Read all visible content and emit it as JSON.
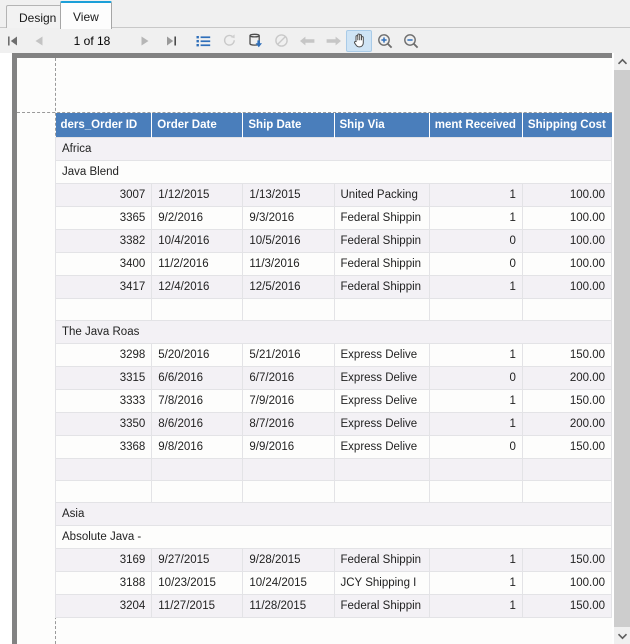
{
  "tabs": [
    {
      "label": "Design",
      "active": false
    },
    {
      "label": "View",
      "active": true
    }
  ],
  "toolbar": {
    "first_page_label": "first-page",
    "prev_page_label": "previous-page",
    "page_indicator": "1 of 18",
    "next_page_label": "next-page",
    "last_page_label": "last-page",
    "toc_label": "table-of-contents",
    "refresh_label": "refresh",
    "export_label": "export",
    "stop_label": "stop",
    "back_label": "back",
    "forward_label": "forward",
    "pan_label": "pan-tool",
    "zoom_in_label": "zoom-in",
    "zoom_out_label": "zoom-out",
    "active_tool": "pan-tool"
  },
  "colors": {
    "header_fill": "#4a7ebb",
    "tab_accent": "#1b9fd8",
    "alt_row": "#f3f1f5",
    "page_bg": "#fdfdfc",
    "frame_gray": "#828282"
  },
  "report": {
    "columns": [
      "ders_Order ID",
      "Order Date",
      "Ship Date",
      "Ship Via",
      "ment Received",
      "Shipping Cost"
    ],
    "rows": [
      {
        "kind": "group",
        "level": 1,
        "label": "Africa",
        "shade": "alt"
      },
      {
        "kind": "group",
        "level": 2,
        "label": "Java Blend",
        "shade": "plain"
      },
      {
        "kind": "data",
        "shade": "alt",
        "cells": [
          "3007",
          "1/12/2015",
          "1/13/2015",
          "United Packing",
          "1",
          "100.00"
        ]
      },
      {
        "kind": "data",
        "shade": "plain",
        "cells": [
          "3365",
          "9/2/2016",
          "9/3/2016",
          "Federal Shippin",
          "1",
          "100.00"
        ]
      },
      {
        "kind": "data",
        "shade": "alt",
        "cells": [
          "3382",
          "10/4/2016",
          "10/5/2016",
          "Federal Shippin",
          "0",
          "100.00"
        ]
      },
      {
        "kind": "data",
        "shade": "plain",
        "cells": [
          "3400",
          "11/2/2016",
          "11/3/2016",
          "Federal Shippin",
          "0",
          "100.00"
        ]
      },
      {
        "kind": "data",
        "shade": "alt",
        "cells": [
          "3417",
          "12/4/2016",
          "12/5/2016",
          "Federal Shippin",
          "1",
          "100.00"
        ]
      },
      {
        "kind": "spacer",
        "shade": "plain"
      },
      {
        "kind": "group",
        "level": 2,
        "label": "The Java Roas",
        "shade": "alt"
      },
      {
        "kind": "data",
        "shade": "plain",
        "cells": [
          "3298",
          "5/20/2016",
          "5/21/2016",
          "Express Delive",
          "1",
          "150.00"
        ]
      },
      {
        "kind": "data",
        "shade": "alt",
        "cells": [
          "3315",
          "6/6/2016",
          "6/7/2016",
          "Express Delive",
          "0",
          "200.00"
        ]
      },
      {
        "kind": "data",
        "shade": "plain",
        "cells": [
          "3333",
          "7/8/2016",
          "7/9/2016",
          "Express Delive",
          "1",
          "150.00"
        ]
      },
      {
        "kind": "data",
        "shade": "alt",
        "cells": [
          "3350",
          "8/6/2016",
          "8/7/2016",
          "Express Delive",
          "1",
          "200.00"
        ]
      },
      {
        "kind": "data",
        "shade": "plain",
        "cells": [
          "3368",
          "9/8/2016",
          "9/9/2016",
          "Express Delive",
          "0",
          "150.00"
        ]
      },
      {
        "kind": "spacer",
        "shade": "alt"
      },
      {
        "kind": "spacer",
        "shade": "plain"
      },
      {
        "kind": "group",
        "level": 1,
        "label": "Asia",
        "shade": "alt"
      },
      {
        "kind": "group",
        "level": 2,
        "label": "Absolute Java -",
        "shade": "plain"
      },
      {
        "kind": "data",
        "shade": "alt",
        "cells": [
          "3169",
          "9/27/2015",
          "9/28/2015",
          "Federal Shippin",
          "1",
          "150.00"
        ]
      },
      {
        "kind": "data",
        "shade": "plain",
        "cells": [
          "3188",
          "10/23/2015",
          "10/24/2015",
          "JCY Shipping I",
          "1",
          "100.00"
        ]
      },
      {
        "kind": "data",
        "shade": "alt",
        "cells": [
          "3204",
          "11/27/2015",
          "11/28/2015",
          "Federal Shippin",
          "1",
          "150.00"
        ]
      }
    ]
  }
}
